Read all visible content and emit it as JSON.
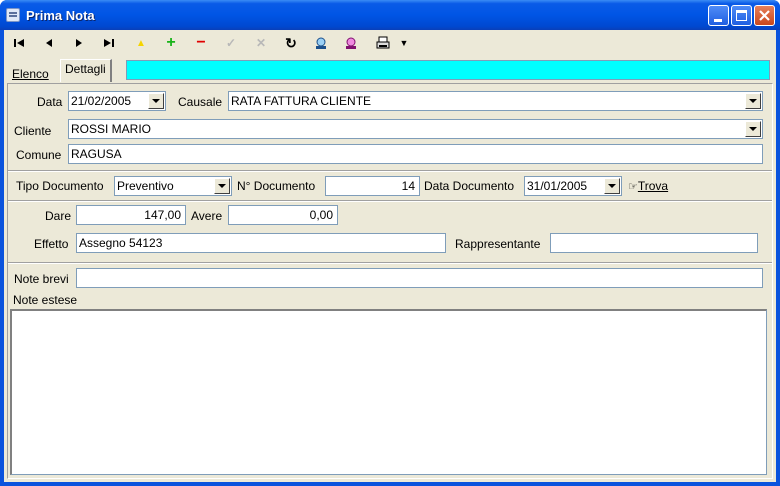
{
  "window": {
    "title": "Prima Nota"
  },
  "toolbar": {
    "buttons": [
      {
        "name": "first-record-icon",
        "glyph": "|◀"
      },
      {
        "name": "prev-record-icon",
        "glyph": "◀"
      },
      {
        "name": "next-record-icon",
        "glyph": "▶"
      },
      {
        "name": "last-record-icon",
        "glyph": "▶|"
      },
      {
        "name": "new-record-icon",
        "glyph": "✦",
        "color": "#f5d400"
      },
      {
        "name": "add-record-icon",
        "glyph": "+",
        "color": "#19b319"
      },
      {
        "name": "delete-record-icon",
        "glyph": "−",
        "color": "#e00000"
      },
      {
        "name": "confirm-icon",
        "glyph": "✓",
        "color": "#b8b8b8"
      },
      {
        "name": "cancel-icon",
        "glyph": "✕",
        "color": "#b8b8b8"
      },
      {
        "name": "refresh-icon",
        "glyph": "↻",
        "color": "#1a1a1a"
      },
      {
        "name": "search-icon",
        "glyph": "⚲",
        "color": "#1b6fb8"
      },
      {
        "name": "filter-icon",
        "glyph": "⚲",
        "color": "#b020a0"
      },
      {
        "name": "print-icon",
        "glyph": "⎙",
        "color": "#000000"
      },
      {
        "name": "dropdown-arrow-icon",
        "glyph": "▾",
        "color": "#000000"
      }
    ]
  },
  "tabs": {
    "elenco": "Elenco",
    "dettagli": "Dettagli"
  },
  "form": {
    "data_label": "Data",
    "data_value": "21/02/2005",
    "causale_label": "Causale",
    "causale_value": "RATA FATTURA CLIENTE",
    "cliente_label": "Cliente",
    "cliente_value": "ROSSI MARIO",
    "comune_label": "Comune",
    "comune_value": "RAGUSA",
    "tipo_doc_label": "Tipo Documento",
    "tipo_doc_value": "Preventivo",
    "num_doc_label": "N° Documento",
    "num_doc_value": "14",
    "data_doc_label": "Data Documento",
    "data_doc_value": "31/01/2005",
    "trova_label": "Trova",
    "dare_label": "Dare",
    "dare_value": "147,00",
    "avere_label": "Avere",
    "avere_value": "0,00",
    "effetto_label": "Effetto",
    "effetto_value": "Assegno 54123",
    "rappresentante_label": "Rappresentante",
    "rappresentante_value": "",
    "note_brevi_label": "Note brevi",
    "note_brevi_value": "",
    "note_estese_label": "Note estese",
    "note_estese_value": ""
  }
}
